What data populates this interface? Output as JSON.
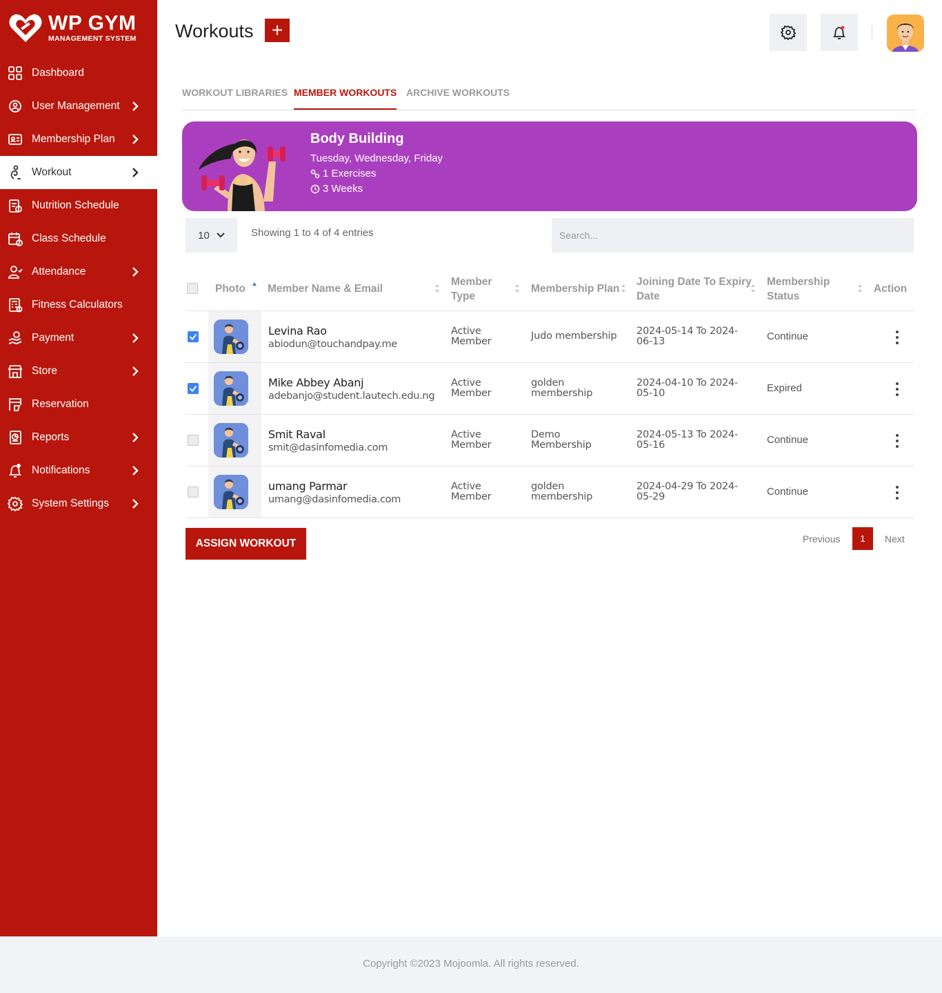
{
  "brand": {
    "title": "WP GYM",
    "subtitle": "MANAGEMENT SYSTEM",
    "color": "#b8160c"
  },
  "sidebar": {
    "items": [
      {
        "label": "Dashboard",
        "icon": "dashboard-icon"
      },
      {
        "label": "User Management",
        "icon": "users-gear-icon"
      },
      {
        "label": "Membership Plan",
        "icon": "membership-card-icon"
      },
      {
        "label": "Workout",
        "icon": "workout-icon",
        "active": true
      },
      {
        "label": "Nutrition Schedule",
        "icon": "nutrition-icon"
      },
      {
        "label": "Class Schedule",
        "icon": "calendar-icon"
      },
      {
        "label": "Attendance",
        "icon": "attendance-icon"
      },
      {
        "label": "Fitness Calculators",
        "icon": "calculator-icon"
      },
      {
        "label": "Payment",
        "icon": "payment-icon"
      },
      {
        "label": "Store",
        "icon": "store-icon"
      },
      {
        "label": "Reservation",
        "icon": "reservation-icon"
      },
      {
        "label": "Reports",
        "icon": "reports-icon"
      },
      {
        "label": "Notifications",
        "icon": "bell-icon"
      },
      {
        "label": "System Settings",
        "icon": "gear-icon"
      }
    ]
  },
  "header": {
    "title": "Workouts",
    "add_label": "+"
  },
  "tabs": [
    {
      "label": "WORKOUT LIBRARIES"
    },
    {
      "label": "MEMBER WORKOUTS",
      "active": true
    },
    {
      "label": "ARCHIVE WORKOUTS"
    }
  ],
  "banner": {
    "title": "Body Building",
    "days": "Tuesday, Wednesday, Friday",
    "exercises": "1 Exercises",
    "duration": "3 Weeks",
    "color": "#a93fbe"
  },
  "table_controls": {
    "page_length": "10",
    "showing": "Showing 1 to 4 of 4 entries",
    "search_placeholder": "Search..."
  },
  "columns": {
    "photo": "Photo",
    "name_email": "Member Name & Email",
    "member_type_1": "Member",
    "member_type_2": "Type",
    "plan": "Membership Plan",
    "dates_1": "Joining Date To Expiry",
    "dates_2": "Date",
    "status_1": "Membership",
    "status_2": "Status",
    "action": "Action"
  },
  "rows": [
    {
      "checked": true,
      "name": "Levina Rao",
      "email": "abiodun@touchandpay.me",
      "type_1": "Active",
      "type_2": "Member",
      "plan_1": "Judo membership",
      "plan_2": "",
      "date_1": "2024-05-14 To 2024-",
      "date_2": "06-13",
      "status": "Continue"
    },
    {
      "checked": true,
      "name": "Mike Abbey Abanj",
      "email": "adebanjo@student.lautech.edu.ng",
      "type_1": "Active",
      "type_2": "Member",
      "plan_1": "golden",
      "plan_2": "membership",
      "date_1": "2024-04-10 To 2024-",
      "date_2": "05-10",
      "status": "Expired"
    },
    {
      "checked": false,
      "name": "Smit Raval",
      "email": "smit@dasinfomedia.com",
      "type_1": "Active",
      "type_2": "Member",
      "plan_1": "Demo",
      "plan_2": "Membership",
      "date_1": "2024-05-13 To 2024-",
      "date_2": "05-16",
      "status": "Continue"
    },
    {
      "checked": false,
      "name": "umang Parmar",
      "email": "umang@dasinfomedia.com",
      "type_1": "Active",
      "type_2": "Member",
      "plan_1": "golden",
      "plan_2": "membership",
      "date_1": "2024-04-29 To 2024-",
      "date_2": "05-29",
      "status": "Continue"
    }
  ],
  "assign_label": "ASSIGN WORKOUT",
  "pagination": {
    "previous": "Previous",
    "current": "1",
    "next": "Next"
  },
  "footer": {
    "text": "Copyright ©2023 Mojoomla. All rights reserved."
  }
}
